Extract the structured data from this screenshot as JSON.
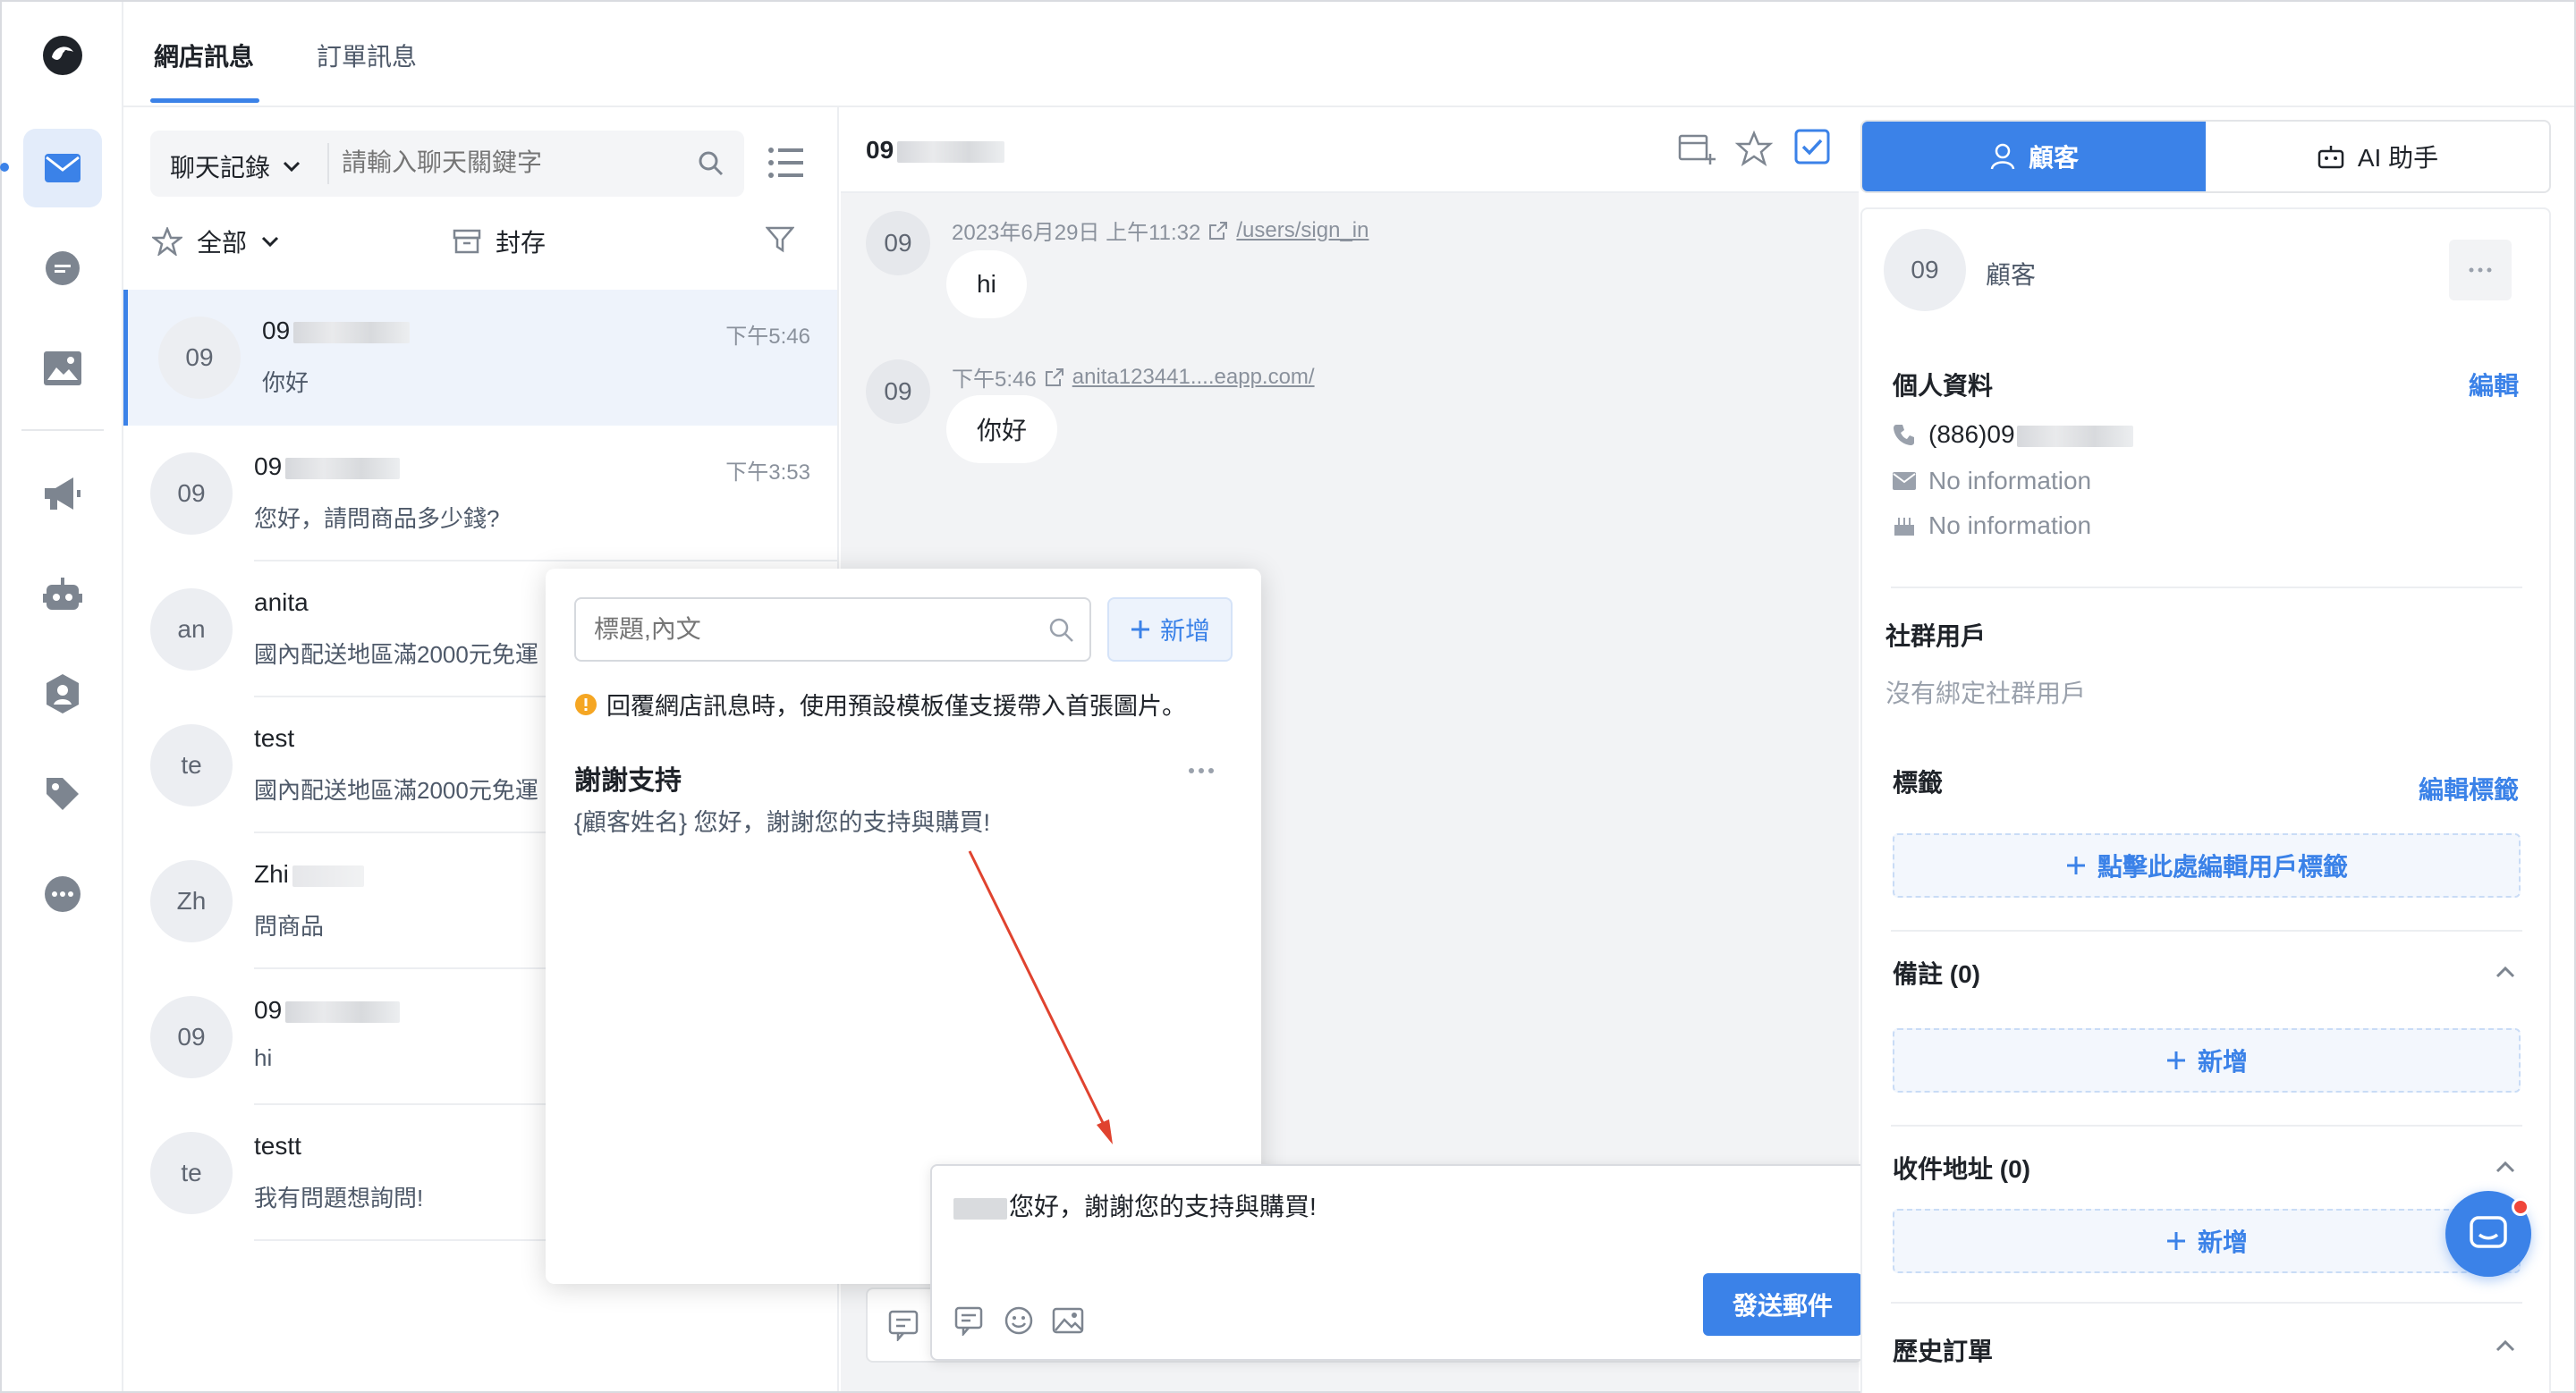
{
  "top_tabs": [
    {
      "label": "網店訊息"
    },
    {
      "label": "訂單訊息"
    }
  ],
  "rail": {
    "items": [
      "mail-icon",
      "chat-icon",
      "image-icon",
      "megaphone-icon",
      "bot-icon",
      "contact-icon",
      "tag-icon",
      "more-icon"
    ]
  },
  "list": {
    "search_scope": "聊天記錄",
    "search_placeholder": "請輸入聊天關鍵字",
    "filter_all": "全部",
    "archive": "封存",
    "conversations": [
      {
        "avatar": "09",
        "name": "09",
        "time": "下午5:46",
        "preview": "你好"
      },
      {
        "avatar": "09",
        "name": "09",
        "time": "下午3:53",
        "preview": "您好，請問商品多少錢?"
      },
      {
        "avatar": "an",
        "name": "anita",
        "time": "",
        "preview": "國內配送地區滿2000元免運"
      },
      {
        "avatar": "te",
        "name": "test",
        "time": "",
        "preview": "國內配送地區滿2000元免運"
      },
      {
        "avatar": "Zh",
        "name": "Zhi",
        "time": "",
        "preview": "問商品"
      },
      {
        "avatar": "09",
        "name": "09",
        "time": "",
        "preview": "hi"
      },
      {
        "avatar": "te",
        "name": "testt",
        "time": "",
        "preview": "我有問題想詢問!"
      }
    ]
  },
  "chat": {
    "title": "09",
    "messages": [
      {
        "avatar": "09",
        "time": "2023年6月29日 上午11:32",
        "link": "/users/sign_in",
        "text": "hi"
      },
      {
        "avatar": "09",
        "time": "下午5:46",
        "link": "anita123441....eapp.com/",
        "text": "你好"
      }
    ]
  },
  "popup": {
    "search_placeholder": "標題,內文",
    "add_label": "新增",
    "notice": "回覆網店訊息時，使用預設模板僅支援帶入首張圖片。",
    "template_title": "謝謝支持",
    "template_body": "{顧客姓名} 您好，謝謝您的支持與購買!"
  },
  "composer": {
    "text": "您好，謝謝您的支持與購買!",
    "send_label": "發送郵件"
  },
  "right": {
    "tab_customer": "顧客",
    "tab_ai": "AI 助手",
    "avatar": "09",
    "role": "顧客",
    "profile_title": "個人資料",
    "edit": "編輯",
    "phone": "(886)09",
    "email": "No information",
    "birthday": "No information",
    "social_title": "社群用戶",
    "social_empty": "沒有綁定社群用戶",
    "tags_title": "標籤",
    "edit_tags": "編輯標籤",
    "tags_button": "點擊此處編輯用戶標籤",
    "notes_title": "備註 (0)",
    "notes_add": "新增",
    "address_title": "收件地址 (0)",
    "address_add": "新增",
    "orders_title": "歷史訂單"
  },
  "colors": {
    "accent": "#3b82e8",
    "arrow": "#e0432f",
    "warning": "#f5a623"
  }
}
